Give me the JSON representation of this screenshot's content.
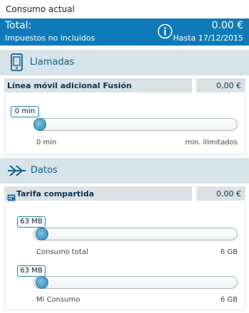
{
  "header": {
    "title": "Consumo actual"
  },
  "total": {
    "label": "Total:",
    "amount": "0.00 €",
    "subtitle": "Impuestos no incluidos",
    "until": "Hasta 17/12/2015",
    "icon": "info-icon"
  },
  "calls": {
    "section_label": "Llamadas",
    "icon": "phone-icon",
    "line": {
      "name": "Línea móvil adicional Fusión",
      "amount": "0,00 €",
      "value_label": "0 min",
      "min_label": "0 min",
      "max_label": "min. ilimitados",
      "fill": 0
    }
  },
  "data": {
    "section_label": "Datos",
    "icon": "double-chevron-right-icon",
    "plan": {
      "name": "Tarifa compartida",
      "amount": "0,00 €",
      "icon": "card-icon",
      "total": {
        "value_label": "63 MB",
        "min_label": "Consumo total",
        "max_label": "6 GB",
        "fill": 0.01
      },
      "mine": {
        "value_label": "63 MB",
        "min_label": "Mi Consumo",
        "max_label": "6 GB",
        "fill": 0.01
      }
    }
  },
  "colors": {
    "accent": "#0e7bb8",
    "section_bg": "#d7e4ea",
    "card_header_bg": "#dbe2e6"
  }
}
